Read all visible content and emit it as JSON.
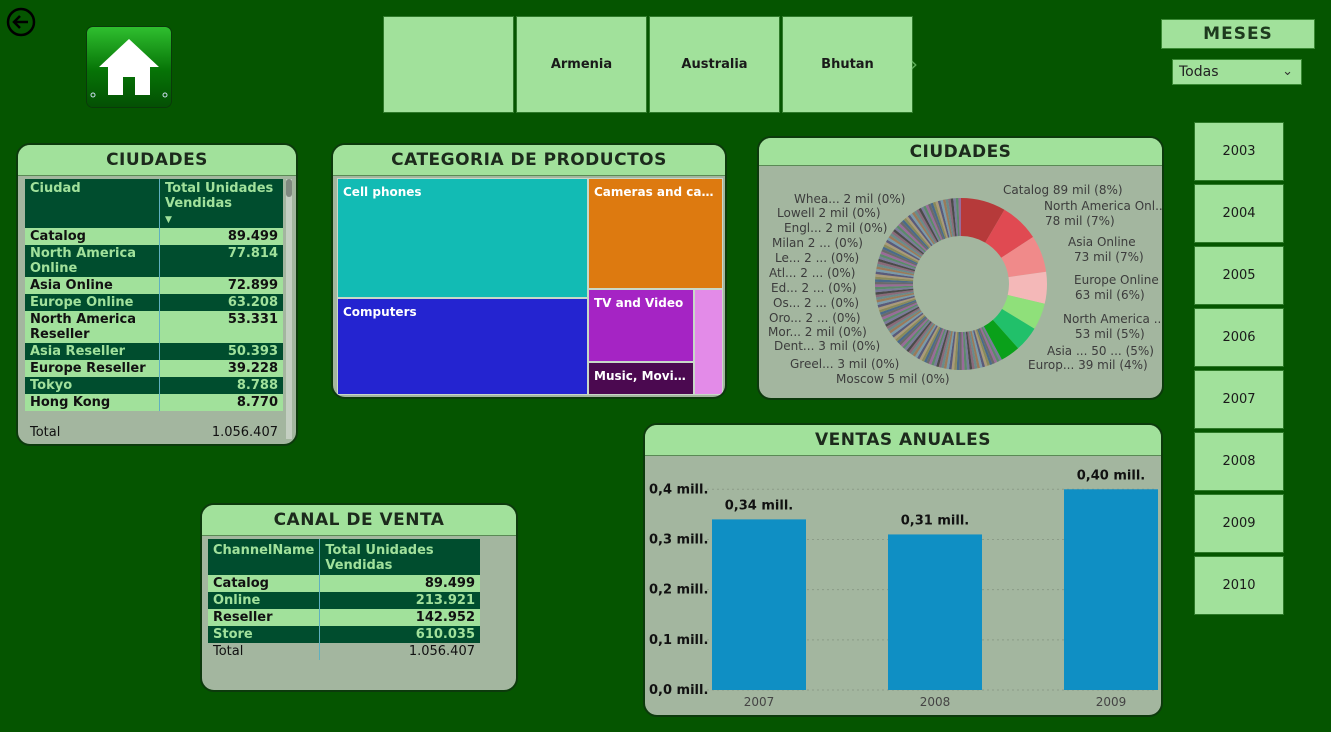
{
  "nav": {
    "back_icon": "arrow-left-circle-icon",
    "home_icon": "home-icon"
  },
  "countries": [
    "",
    "Armenia",
    "Australia",
    "Bhutan"
  ],
  "meses": {
    "title": "MESES",
    "selected": "Todas"
  },
  "years": [
    "2003",
    "2004",
    "2005",
    "2006",
    "2007",
    "2008",
    "2009",
    "2010"
  ],
  "ciudades_table": {
    "title": "CIUDADES",
    "headers": [
      "Ciudad",
      "Total Unidades Vendidas"
    ],
    "rows": [
      {
        "city": "Catalog",
        "value": "89.499"
      },
      {
        "city": "North America Online",
        "value": "77.814"
      },
      {
        "city": "Asia Online",
        "value": "72.899"
      },
      {
        "city": "Europe Online",
        "value": "63.208"
      },
      {
        "city": "North America Reseller",
        "value": "53.331"
      },
      {
        "city": "Asia Reseller",
        "value": "50.393"
      },
      {
        "city": "Europe Reseller",
        "value": "39.228"
      },
      {
        "city": "Tokyo",
        "value": "8.788"
      },
      {
        "city": "Hong Kong",
        "value": "8.770"
      }
    ],
    "total_label": "Total",
    "total_value": "1.056.407"
  },
  "categorias": {
    "title": "CATEGORIA DE PRODUCTOS",
    "items": [
      {
        "label": "Cell phones",
        "color": "#12bbb4"
      },
      {
        "label": "Cameras and cam...",
        "color": "#dd7a10"
      },
      {
        "label": "Computers",
        "color": "#2424d0"
      },
      {
        "label": "TV and Video",
        "color": "#a524c4"
      },
      {
        "label": "Music, Movie...",
        "color": "#4b0950"
      },
      {
        "label": "",
        "color": "#e38be8"
      }
    ]
  },
  "ciudades_donut": {
    "title": "CIUDADES",
    "labels_right": [
      "Catalog 89 mil (8%)",
      "North America Onl...",
      "78 mil (7%)",
      "Asia Online",
      "73 mil (7%)",
      "Europe Online",
      "63 mil (6%)",
      "North America ...",
      "53 mil (5%)",
      "Asia ... 50 ... (5%)",
      "Europ... 39 mil (4%)"
    ],
    "labels_left": [
      "Whea... 2 mil (0%)",
      "Lowell 2 mil (0%)",
      "Engl... 2 mil (0%)",
      "Milan 2 ... (0%)",
      "Le... 2 ... (0%)",
      "Atl... 2 ... (0%)",
      "Ed... 2 ... (0%)",
      "Os... 2 ... (0%)",
      "Oro... 2 ... (0%)",
      "Mor... 2 mil (0%)",
      "Dent... 3 mil (0%)",
      "Greel... 3 mil (0%)",
      "Moscow 5 mil (0%)"
    ],
    "slices": [
      {
        "value": 89,
        "color": "#b63a3a"
      },
      {
        "value": 78,
        "color": "#e04a52"
      },
      {
        "value": 73,
        "color": "#f08a8a"
      },
      {
        "value": 63,
        "color": "#f4b8b8"
      },
      {
        "value": 53,
        "color": "#8fe07a"
      },
      {
        "value": 50,
        "color": "#21c06a"
      },
      {
        "value": 39,
        "color": "#0aa01a"
      }
    ]
  },
  "canal": {
    "title": "CANAL DE VENTA",
    "headers": [
      "ChannelName",
      "Total Unidades Vendidas"
    ],
    "rows": [
      {
        "name": "Catalog",
        "value": "89.499"
      },
      {
        "name": "Online",
        "value": "213.921"
      },
      {
        "name": "Reseller",
        "value": "142.952"
      },
      {
        "name": "Store",
        "value": "610.035"
      }
    ],
    "total_label": "Total",
    "total_value": "1.056.407"
  },
  "ventas": {
    "title": "VENTAS ANUALES",
    "chart_data": {
      "type": "bar",
      "categories": [
        "2007",
        "2008",
        "2009"
      ],
      "values": [
        0.34,
        0.31,
        0.4
      ],
      "data_labels": [
        "0,34 mill.",
        "0,31 mill.",
        "0,40 mill."
      ],
      "y_ticks": [
        "0,0 mill.",
        "0,1 mill.",
        "0,2 mill.",
        "0,3 mill.",
        "0,4 mill."
      ],
      "ylim": [
        0,
        0.4
      ],
      "color": "#0f8fc4"
    }
  }
}
